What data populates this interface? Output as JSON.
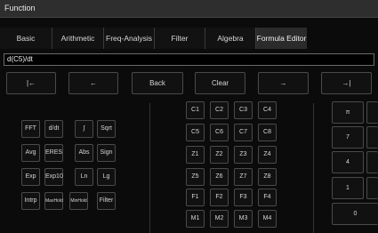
{
  "window": {
    "title": "Function"
  },
  "tabs": [
    {
      "label": "Basic"
    },
    {
      "label": "Arithmetic"
    },
    {
      "label": "Freq-Analysis"
    },
    {
      "label": "Filter"
    },
    {
      "label": "Algebra"
    },
    {
      "label": "Formula Editor",
      "active": true
    }
  ],
  "formula": {
    "value": "d(C5)/dt"
  },
  "controls": {
    "home": "|←",
    "left": "←",
    "back": "Back",
    "clear": "Clear",
    "right": "→",
    "end": "→|"
  },
  "functions": [
    [
      "FFT",
      "d/dt",
      "∫",
      "Sqrt"
    ],
    [
      "Avg",
      "ERES",
      "Abs",
      "Sign"
    ],
    [
      "Exp",
      "Exp10",
      "Ln",
      "Lg"
    ],
    [
      "Intrp",
      "MaxHold",
      "MinHold",
      "Filter"
    ]
  ],
  "registers": [
    [
      "C1",
      "C2",
      "C3",
      "C4"
    ],
    [
      "C5",
      "C6",
      "C7",
      "C8"
    ],
    [
      "Z1",
      "Z2",
      "Z3",
      "Z4"
    ],
    [
      "Z5",
      "Z6",
      "Z7",
      "Z8"
    ],
    [
      "F1",
      "F2",
      "F3",
      "F4"
    ],
    [
      "M1",
      "M2",
      "M3",
      "M4"
    ]
  ],
  "keypad": [
    "π",
    "7",
    "4",
    "1",
    "0"
  ]
}
